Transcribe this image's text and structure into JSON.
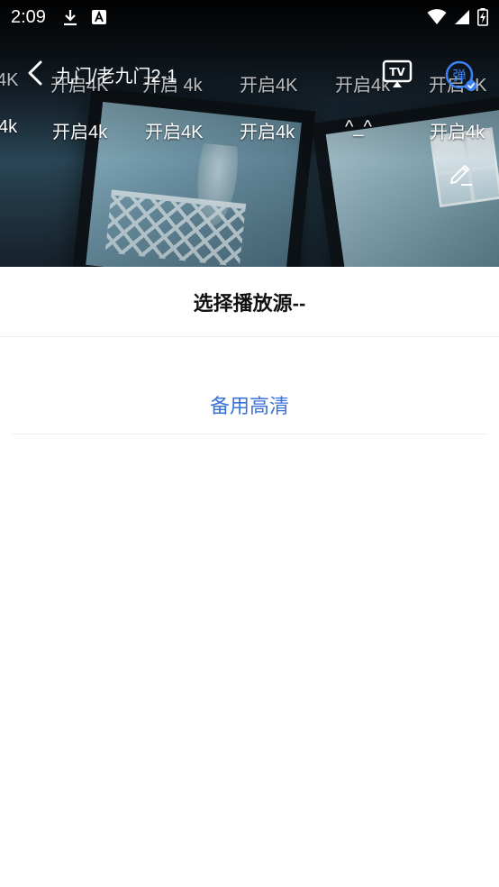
{
  "status_bar": {
    "time": "2:09",
    "left_icons": [
      "download-icon",
      "font-a-icon"
    ],
    "right_icons": [
      "wifi-icon",
      "signal-icon",
      "battery-charging-icon"
    ]
  },
  "player": {
    "title": "九门/老九门2-1",
    "tv_label": "TV",
    "danmaku_label": "弹"
  },
  "danmaku": {
    "row1": [
      "4K",
      "开启4K",
      "开启 4k",
      "开启4K",
      "开启4k",
      "开启4K"
    ],
    "row2": [
      "4k",
      "开启4k",
      "开启4K",
      "开启4k",
      "^_^",
      "开启4k"
    ]
  },
  "source_sheet": {
    "title": "选择播放源--",
    "sources": [
      "备用高清"
    ]
  },
  "colors": {
    "accent": "#3b73d9",
    "danmaku_toggle": "#3b82f6"
  }
}
